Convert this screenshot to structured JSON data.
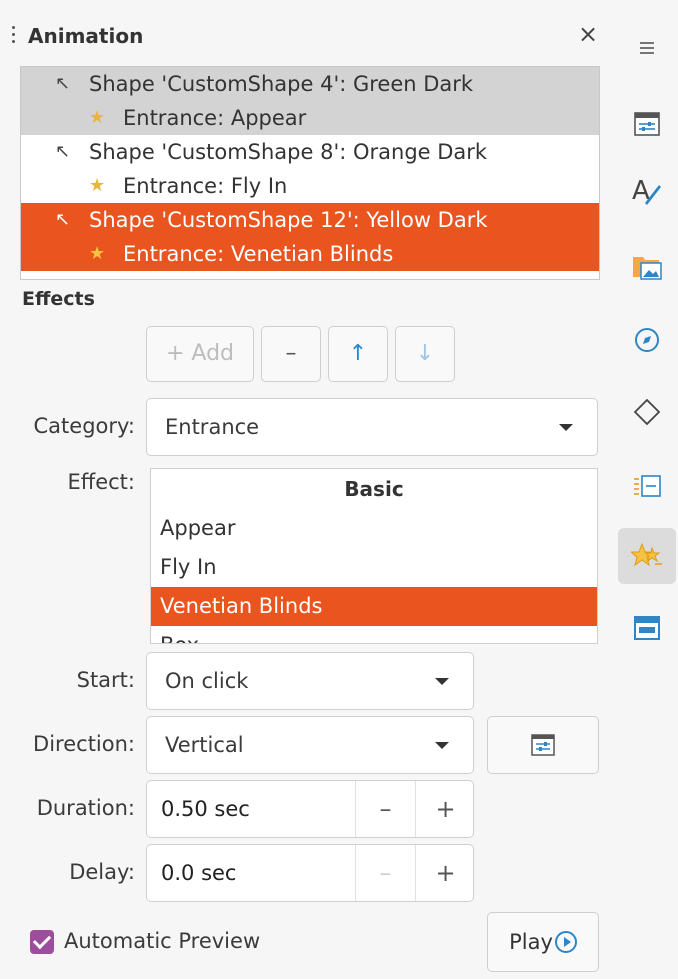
{
  "panel": {
    "title": "Animation",
    "close_glyph": "×"
  },
  "animation_list": [
    {
      "text": "Shape 'CustomShape 4': Green Dark",
      "indent": 0,
      "state": "grey",
      "icon": "shape-cursor-icon"
    },
    {
      "text": "Entrance: Appear",
      "indent": 1,
      "state": "grey",
      "icon": "entrance-star-icon"
    },
    {
      "text": "Shape 'CustomShape 8': Orange Dark",
      "indent": 0,
      "state": "none",
      "icon": "shape-cursor-icon"
    },
    {
      "text": "Entrance: Fly In",
      "indent": 1,
      "state": "none",
      "icon": "entrance-star-icon"
    },
    {
      "text": "Shape 'CustomShape 12': Yellow Dark",
      "indent": 0,
      "state": "orange",
      "icon": "shape-cursor-icon"
    },
    {
      "text": "Entrance: Venetian Blinds",
      "indent": 1,
      "state": "orange",
      "icon": "entrance-star-icon"
    }
  ],
  "effects": {
    "section_label": "Effects",
    "add_label": "+ Add",
    "remove_glyph": "–",
    "up_glyph": "↑",
    "down_glyph": "↓",
    "category_label": "Category:",
    "category_value": "Entrance",
    "effect_label": "Effect:",
    "effect_group": "Basic",
    "effect_items": [
      "Appear",
      "Fly In",
      "Venetian Blinds",
      "Box"
    ],
    "effect_selected": "Venetian Blinds",
    "start_label": "Start:",
    "start_value": "On click",
    "direction_label": "Direction:",
    "direction_value": "Vertical",
    "duration_label": "Duration:",
    "duration_value": "0.50 sec",
    "delay_label": "Delay:",
    "delay_value": "0.0 sec",
    "minus_glyph": "–",
    "plus_glyph": "+",
    "auto_preview_label": "Automatic Preview",
    "auto_preview_checked": true,
    "play_label": "Play"
  },
  "colors": {
    "selection_orange": "#e9541f",
    "selection_grey": "#d3d3d3",
    "accent_blue": "#2c86c7",
    "checkbox_purple": "#9c4d9b"
  },
  "deck": [
    {
      "icon": "hamburger-menu-icon"
    },
    {
      "icon": "properties-icon"
    },
    {
      "icon": "styles-icon"
    },
    {
      "icon": "gallery-icon"
    },
    {
      "icon": "navigator-icon"
    },
    {
      "icon": "shapes-icon"
    },
    {
      "icon": "slide-transition-icon"
    },
    {
      "icon": "animation-icon",
      "selected": true
    },
    {
      "icon": "master-slides-icon"
    }
  ]
}
